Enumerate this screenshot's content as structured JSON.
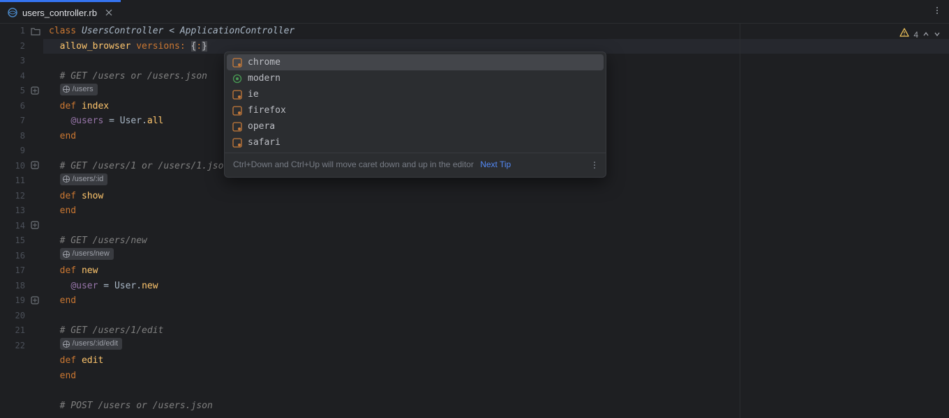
{
  "tab": {
    "filename": "users_controller.rb"
  },
  "inspections": {
    "warnings": "4"
  },
  "code": {
    "line1": {
      "kw": "class",
      "name": "UsersController",
      "op": "<",
      "parent": "ApplicationController"
    },
    "line2": {
      "method": "allow_browser",
      "argkey": "versions:",
      "braces": "{:}",
      "brace_open": "{",
      "colon_sym": ":",
      "brace_close": "}"
    },
    "comment_index": "# GET /users or /users.json",
    "route_index": "/users",
    "def_index": "index",
    "body_index_ivar": "@users",
    "body_index_eq": " = ",
    "body_index_const": "User",
    "body_index_dot": ".",
    "body_index_call": "all",
    "end": "end",
    "def": "def",
    "comment_show": "# GET /users/1 or /users/1.json",
    "route_show": "/users/:id",
    "def_show": "show",
    "comment_new": "# GET /users/new",
    "route_new": "/users/new",
    "def_new": "new",
    "body_new_ivar": "@user",
    "body_new_eq": " = ",
    "body_new_const": "User",
    "body_new_dot": ".",
    "body_new_call": "new",
    "comment_edit": "# GET /users/1/edit",
    "route_edit": "/users/:id/edit",
    "def_edit": "edit",
    "comment_create": "# POST /users or /users.json"
  },
  "completion": {
    "items": [
      {
        "label": "chrome",
        "kind": "symbol"
      },
      {
        "label": "modern",
        "kind": "constant"
      },
      {
        "label": "ie",
        "kind": "symbol"
      },
      {
        "label": "firefox",
        "kind": "symbol"
      },
      {
        "label": "opera",
        "kind": "symbol"
      },
      {
        "label": "safari",
        "kind": "symbol"
      }
    ],
    "tip_text": "Ctrl+Down and Ctrl+Up will move caret down and up in the editor",
    "next_tip": "Next Tip"
  },
  "gutter": {
    "lines": [
      "1",
      "2",
      "3",
      "4",
      "5",
      "6",
      "7",
      "8",
      "9",
      "10",
      "11",
      "12",
      "13",
      "14",
      "15",
      "16",
      "17",
      "18",
      "19",
      "20",
      "21",
      "22"
    ]
  }
}
